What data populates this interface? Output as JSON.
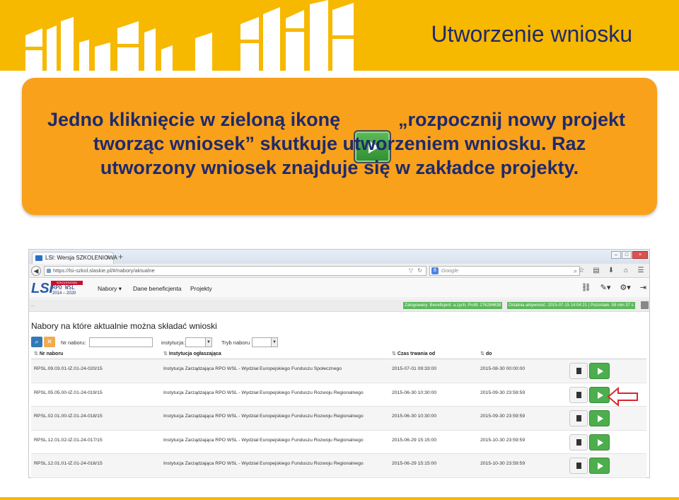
{
  "slide": {
    "title": "Utworzenie wniosku",
    "colors": {
      "header": "#f7b800",
      "callout": "#f9a11b",
      "text": "#1f2a6b"
    }
  },
  "callout": {
    "line1_a": "Jedno kliknięcie w zieloną ikonę",
    "line1_b": "„rozpocznij nowy projekt",
    "line2": "tworząc wniosek” skutkuje utworzeniem wniosku. Raz",
    "line3": "utworzony wniosek znajduje się w zakładce projekty.",
    "icon": "play-icon"
  },
  "browser": {
    "tab_title": "LSI: Wersja SZKOLENIOWA",
    "tab_close": "×",
    "new_tab": "+",
    "url": "https://lsi-szkol.slaskie.pl/#/nabory/aktualne",
    "search_placeholder": "Google",
    "search_engine_glyph": "8"
  },
  "app": {
    "logo_text": "LSI",
    "logo_badge": "SZKOLENIOWA",
    "logo_sub": "RPO WSL",
    "logo_years": "2014 – 2020",
    "menu": [
      "Nabory",
      "Dane beneficjenta",
      "Projekty"
    ],
    "status_dots": "..",
    "user_badge": "Zalogowany: Beneficjent: a.zych; Profil: 276284638",
    "activity_badge": "Ostatnia aktywność: 2015-07-15 14:04:21 | Pozostało: 59 min 37 s"
  },
  "page": {
    "heading": "Nabory na które aktualnie można składać wnioski",
    "filters": {
      "nr_label": "Nr naboru:",
      "inst_label": "instytucja:",
      "tryb_label": "Tryb naboru"
    }
  },
  "table": {
    "columns": [
      "Nr naboru",
      "Instytucja ogłaszająca",
      "Czas trwania od",
      "do"
    ],
    "rows": [
      {
        "nr": "RPSL.09.03.01-IZ.01-24-020/15",
        "inst": "Instytucja Zarządzająca RPO WSL - Wydział Europejskiego Funduszu Społecznego",
        "od": "2015-07-01 09:33:00",
        "do": "2015-08-30 00:00:00"
      },
      {
        "nr": "RPSL.05.05.00-IZ.01-24-019/15",
        "inst": "Instytucja Zarządzająca RPO WSL - Wydział Europejskiego Funduszu Rozwoju Regionalnego",
        "od": "2015-06-30 10:30:00",
        "do": "2015-09-30 23:59:59"
      },
      {
        "nr": "RPSL.02.01.00-IZ.01-24-018/15",
        "inst": "Instytucja Zarządzająca RPO WSL - Wydział Europejskiego Funduszu Rozwoju Regionalnego",
        "od": "2015-06-30 10:30:00",
        "do": "2015-09-30 23:59:59"
      },
      {
        "nr": "RPSL.12.01.02-IZ.01-24-017/15",
        "inst": "Instytucja Zarządzająca RPO WSL - Wydział Europejskiego Funduszu Rozwoju Regionalnego",
        "od": "2015-06-29 15:15:00",
        "do": "2015-10-30 23:59:59"
      },
      {
        "nr": "RPSL.12.01.01-IZ.01-24-016/15",
        "inst": "Instytucja Zarządzająca RPO WSL - Wydział Europejskiego Funduszu Rozwoju Regionalnego",
        "od": "2015-06-29 15:15:00",
        "do": "2015-10-30 23:59:59"
      }
    ],
    "row_action_icons": [
      "document-icon",
      "play-icon"
    ],
    "highlighted_row": 1
  }
}
